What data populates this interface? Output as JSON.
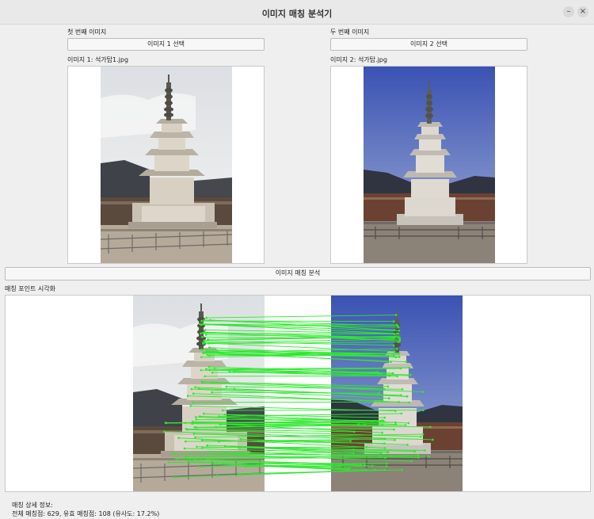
{
  "window": {
    "title": "이미지 매칭 분석기",
    "minimize_icon": "–",
    "close_icon": "×"
  },
  "left": {
    "heading": "첫 번째 이미지",
    "button": "이미지 1 선택",
    "file_label": "이미지 1: 석가탑1.jpg"
  },
  "right": {
    "heading": "두 번째 이미지",
    "button": "이미지 2 선택",
    "file_label": "이미지 2: 석가탑.jpg"
  },
  "analyze_button": "이미지 매칭 분석",
  "viz": {
    "heading": "매칭 포인트 시각화"
  },
  "details": {
    "heading": "매칭 상세 정보:",
    "summary": "전체 매칭점: 629, 유효 매칭점: 108 (유사도: 17.2%)"
  },
  "colors": {
    "match_line": "#2ee82e",
    "sky_left": "#e4e7ea",
    "sky_right": "#4d63b8"
  }
}
